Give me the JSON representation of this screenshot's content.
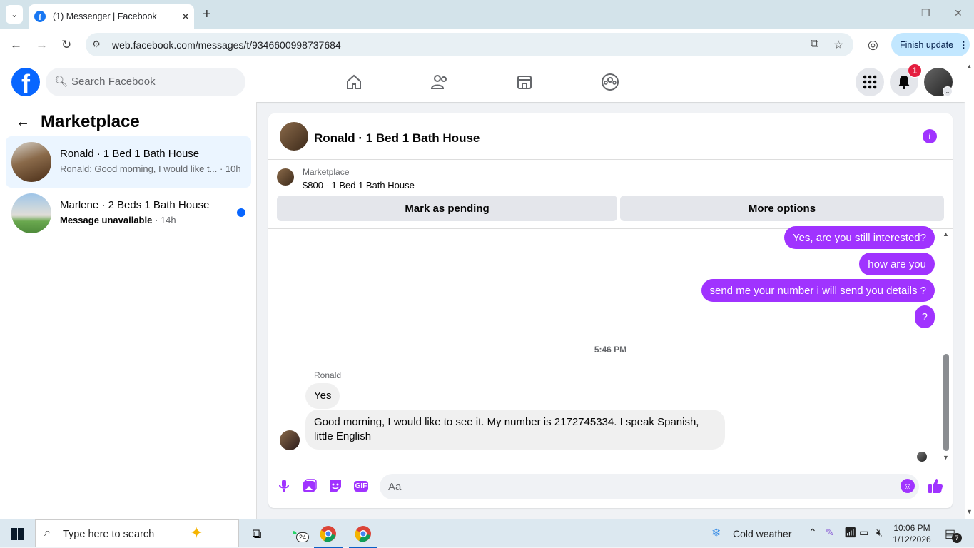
{
  "browser": {
    "tab_title": "(1) Messenger | Facebook",
    "url": "web.facebook.com/messages/t/9346600998737684",
    "finish_update": "Finish update"
  },
  "fb": {
    "search_placeholder": "Search Facebook",
    "notification_count": "1"
  },
  "left": {
    "title": "Marketplace",
    "conversations": [
      {
        "name": "Ronald · 1 Bed 1 Bath House",
        "preview": "Ronald: Good morning, I would like t...",
        "time": "· 10h",
        "active": true,
        "unread": false
      },
      {
        "name": "Marlene · 2 Beds 1 Bath House",
        "preview": "Message unavailable",
        "time": "· 14h",
        "active": false,
        "unread": true
      }
    ]
  },
  "chat": {
    "title": "Ronald · 1 Bed 1 Bath House",
    "marketplace_label": "Marketplace",
    "listing": "$800 - 1 Bed 1 Bath House",
    "mark_pending": "Mark as pending",
    "more_options": "More options",
    "outgoing": [
      "Yes, are you still interested?",
      "how are you",
      "send me your number i will send you details ?",
      "?"
    ],
    "timestamp": "5:46 PM",
    "sender": "Ronald",
    "incoming": [
      "Yes",
      "Good morning, I would like to see it. My number is 2172745334. I speak Spanish, little English"
    ],
    "composer_placeholder": "Aa",
    "gif_label": "GIF"
  },
  "taskbar": {
    "search_placeholder": "Type here to search",
    "whatsapp_badge": "24",
    "weather": "Cold weather",
    "time": "10:06 PM",
    "date": "1/12/2026",
    "notification_count": "7"
  },
  "colors": {
    "messenger_purple": "#a033ff",
    "facebook_blue": "#0866ff"
  }
}
